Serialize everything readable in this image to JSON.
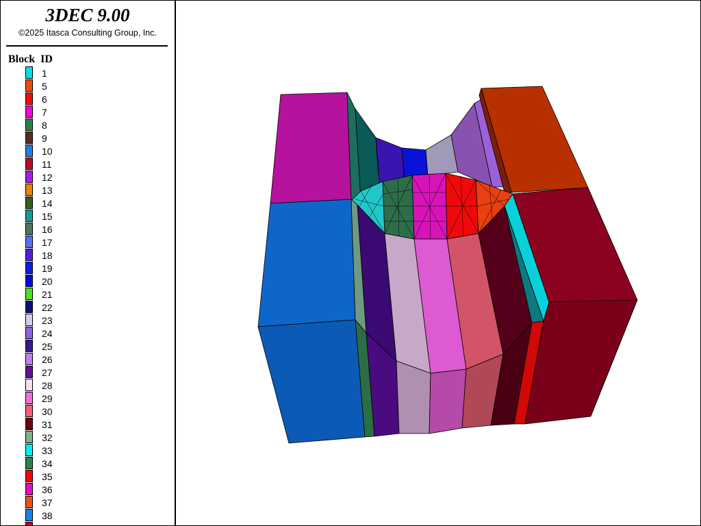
{
  "app": {
    "title": "3DEC 9.00",
    "copyright": "©2025 Itasca Consulting Group, Inc."
  },
  "legend": {
    "heading": "Block  ID",
    "items": [
      {
        "label": "1",
        "color": "#00e0e8"
      },
      {
        "label": "5",
        "color": "#ee4a12"
      },
      {
        "label": "6",
        "color": "#f20d0d"
      },
      {
        "label": "7",
        "color": "#e80bd0"
      },
      {
        "label": "8",
        "color": "#2f7d4a"
      },
      {
        "label": "9",
        "color": "#5a2e25"
      },
      {
        "label": "10",
        "color": "#1f7fe6"
      },
      {
        "label": "11",
        "color": "#b01030"
      },
      {
        "label": "12",
        "color": "#a020e8"
      },
      {
        "label": "13",
        "color": "#f08010"
      },
      {
        "label": "14",
        "color": "#385c25"
      },
      {
        "label": "15",
        "color": "#189a8c"
      },
      {
        "label": "16",
        "color": "#4a7a5a"
      },
      {
        "label": "17",
        "color": "#5a70f0"
      },
      {
        "label": "18",
        "color": "#5020d8"
      },
      {
        "label": "19",
        "color": "#1020d8"
      },
      {
        "label": "20",
        "color": "#0008e0"
      },
      {
        "label": "21",
        "color": "#50e020"
      },
      {
        "label": "22",
        "color": "#081078"
      },
      {
        "label": "23",
        "color": "#d6ccf2"
      },
      {
        "label": "24",
        "color": "#9060e8"
      },
      {
        "label": "25",
        "color": "#3a1890"
      },
      {
        "label": "26",
        "color": "#c080f0"
      },
      {
        "label": "27",
        "color": "#601098"
      },
      {
        "label": "28",
        "color": "#f4e0f4"
      },
      {
        "label": "29",
        "color": "#f070d8"
      },
      {
        "label": "30",
        "color": "#f06078"
      },
      {
        "label": "31",
        "color": "#700010"
      },
      {
        "label": "32",
        "color": "#80b090"
      },
      {
        "label": "33",
        "color": "#00f0f0"
      },
      {
        "label": "34",
        "color": "#308050"
      },
      {
        "label": "35",
        "color": "#f00808"
      },
      {
        "label": "36",
        "color": "#e010c0"
      },
      {
        "label": "37",
        "color": "#f05010"
      },
      {
        "label": "38",
        "color": "#1880e8"
      },
      {
        "label": "",
        "color": "#c00020"
      }
    ]
  }
}
